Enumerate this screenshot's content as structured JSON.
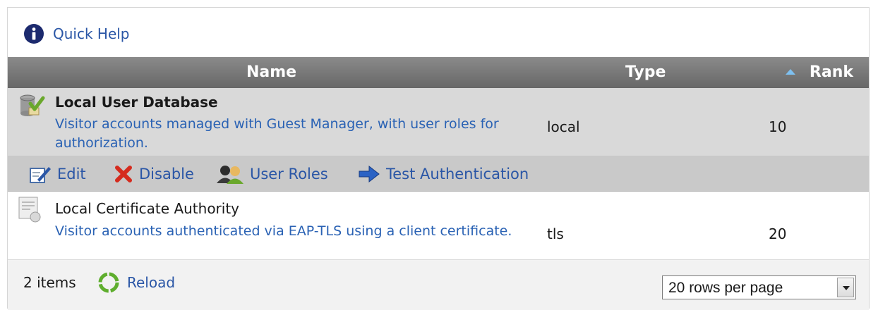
{
  "quick_help": {
    "label": "Quick Help"
  },
  "table": {
    "columns": {
      "name": "Name",
      "type": "Type",
      "rank": "Rank"
    },
    "sort": {
      "column": "Rank",
      "direction": "ascending"
    },
    "rows": [
      {
        "title": "Local User Database",
        "description": "Visitor accounts managed with Guest Manager, with user roles for authorization.",
        "type": "local",
        "rank": "10",
        "icon": "database-check-icon"
      },
      {
        "title": "Local Certificate Authority",
        "description": "Visitor accounts authenticated via EAP-TLS using a client certificate.",
        "type": "tls",
        "rank": "20",
        "icon": "certificate-icon"
      }
    ],
    "row_actions": {
      "edit": "Edit",
      "disable": "Disable",
      "user_roles": "User Roles",
      "test_auth": "Test Authentication"
    }
  },
  "footer": {
    "count": "2 items",
    "reload": "Reload",
    "rows_per_page": "20 rows per page"
  },
  "colors": {
    "link": "#2a56a6",
    "header_bg": "#777777",
    "selected_row_bg": "#d9d9d9"
  }
}
